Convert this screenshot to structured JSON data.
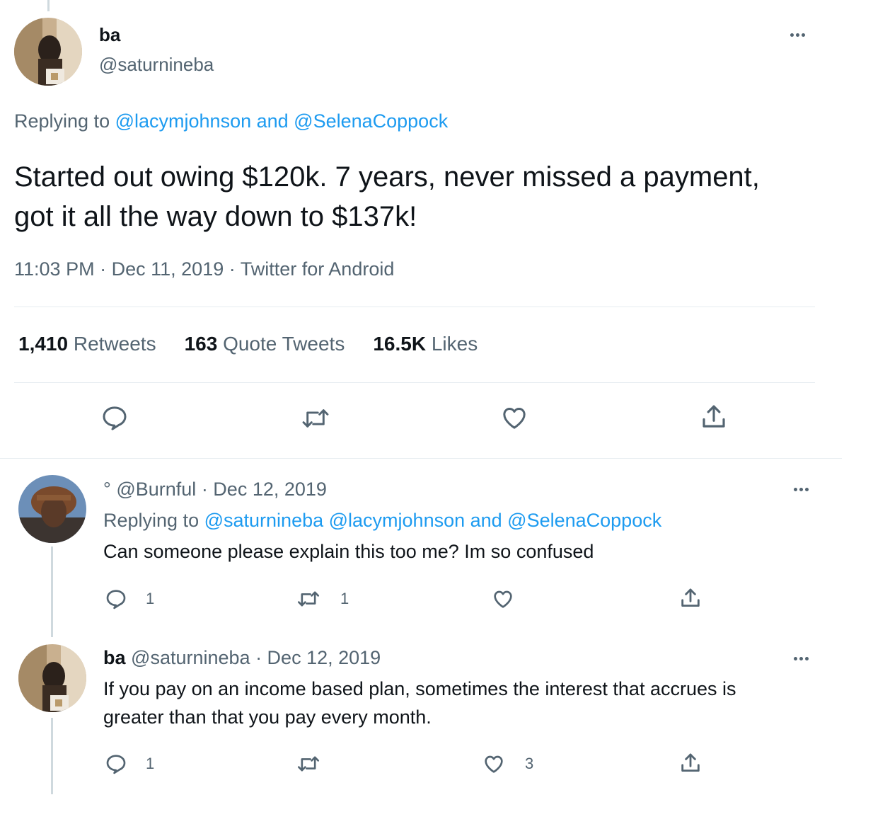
{
  "main_tweet": {
    "author_name": "ba",
    "author_handle": "@saturnineba",
    "replying_prefix": "Replying to",
    "replying_to": "@lacymjohnson and @SelenaCoppock",
    "text": "Started out owing $120k. 7 years, never missed a payment, got it all the way down to $137k!",
    "time": "11:03 PM",
    "date": "Dec 11, 2019",
    "source": "Twitter for Android",
    "meta_sep": "·",
    "stats": [
      {
        "count": "1,410",
        "label": "Retweets"
      },
      {
        "count": "163",
        "label": "Quote Tweets"
      },
      {
        "count": "16.5K",
        "label": "Likes"
      }
    ],
    "actions": [
      "reply-icon",
      "retweet-icon",
      "like-icon",
      "share-icon"
    ]
  },
  "replies": [
    {
      "name_prefix": "°",
      "handle": "@Burnful",
      "date": "· Dec 12, 2019",
      "replying_prefix": "Replying to",
      "replying_to": "@saturnineba @lacymjohnson and @SelenaCoppock",
      "text": "Can someone please explain this too me? Im so confused",
      "reply_count": "1",
      "retweet_count": "1",
      "like_count": ""
    },
    {
      "name": "ba",
      "handle": "@saturnineba",
      "date": "· Dec 12, 2019",
      "text_line1": "If you pay on an income based plan, sometimes the interest that accrues is",
      "text_line2": "greater than that you pay every month.",
      "reply_count": "1",
      "retweet_count": "",
      "like_count": "3"
    }
  ],
  "colors": {
    "link": "#1d9bf0",
    "muted": "#536471",
    "text": "#0f1419",
    "divider": "#e6ecf0"
  }
}
